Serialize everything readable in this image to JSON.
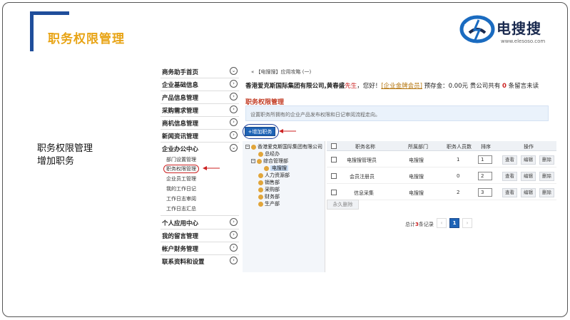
{
  "slide": {
    "title": "职务权限管理",
    "caption_line1": "职务权限管理",
    "caption_line2": "增加职务"
  },
  "logo": {
    "name": "电搜搜",
    "url": "www.elesoso.com",
    "colors": {
      "blue": "#1a6bc0",
      "dark": "#1a2a4f"
    }
  },
  "menu": {
    "items": [
      {
        "label": "商务助手首页",
        "icon": "chevron-down-icon"
      },
      {
        "label": "企业基础信息",
        "icon": "chevron-right-icon"
      },
      {
        "label": "产品信息管理",
        "icon": "chevron-right-icon"
      },
      {
        "label": "采购需求管理",
        "icon": "chevron-right-icon"
      },
      {
        "label": "商机信息管理",
        "icon": "chevron-right-icon"
      },
      {
        "label": "新闻资讯管理",
        "icon": "chevron-right-icon"
      },
      {
        "label": "企业办公中心",
        "icon": "chevron-down-icon"
      },
      {
        "label": "个人应用中心",
        "icon": "chevron-right-icon"
      },
      {
        "label": "我的留言管理",
        "icon": "chevron-right-icon"
      },
      {
        "label": "帐户财务管理",
        "icon": "chevron-right-icon"
      },
      {
        "label": "联系资料和设置",
        "icon": "chevron-right-icon"
      }
    ],
    "office_sub": [
      "部门设置管理",
      "职务权限管理",
      "企业员工管理",
      "我的工作日记",
      "工作日志审阅",
      "工作日志汇总"
    ]
  },
  "content": {
    "breadcrumb": "【电搜搜】应用攻略 (一)",
    "company_name": "香港爱克斯国际集团有限公司,",
    "user_name": "黄春盛",
    "user_title": "先生",
    "greeting": "，您好！",
    "member_level": "[企业金牌会员]",
    "deposit": "预存金：0.00元",
    "messages_pre": "贵公司共有",
    "messages_count": "0",
    "messages_post": "条留言未读",
    "page_title": "职务权限管理",
    "description": "设置职务所拥有的企业产品发布权限和日记审阅流程走向。",
    "add_button": "+增加职务"
  },
  "tree": {
    "root": "香港爱克斯国际集团有限公司",
    "nodes": [
      "总经办",
      "综合管理部",
      "电搜搜",
      "人力资源部",
      "销售部",
      "采购部",
      "财务部",
      "生产部"
    ]
  },
  "table": {
    "headers": [
      "职务名称",
      "所属部门",
      "职务人员数",
      "排序",
      "操作"
    ],
    "rows": [
      {
        "name": "电搜搜管理员",
        "dept": "电搜搜",
        "count": "1",
        "sort": "1"
      },
      {
        "name": "会员注册员",
        "dept": "电搜搜",
        "count": "0",
        "sort": "2"
      },
      {
        "name": "信息采集",
        "dept": "电搜搜",
        "count": "2",
        "sort": "3"
      }
    ],
    "ops": [
      "查看",
      "编辑",
      "删除"
    ],
    "delete_perm": "永久删除",
    "pager_pre": "总计",
    "pager_count": "3",
    "pager_post": "条记录",
    "prev": "‹",
    "page": "1",
    "next": "›"
  }
}
